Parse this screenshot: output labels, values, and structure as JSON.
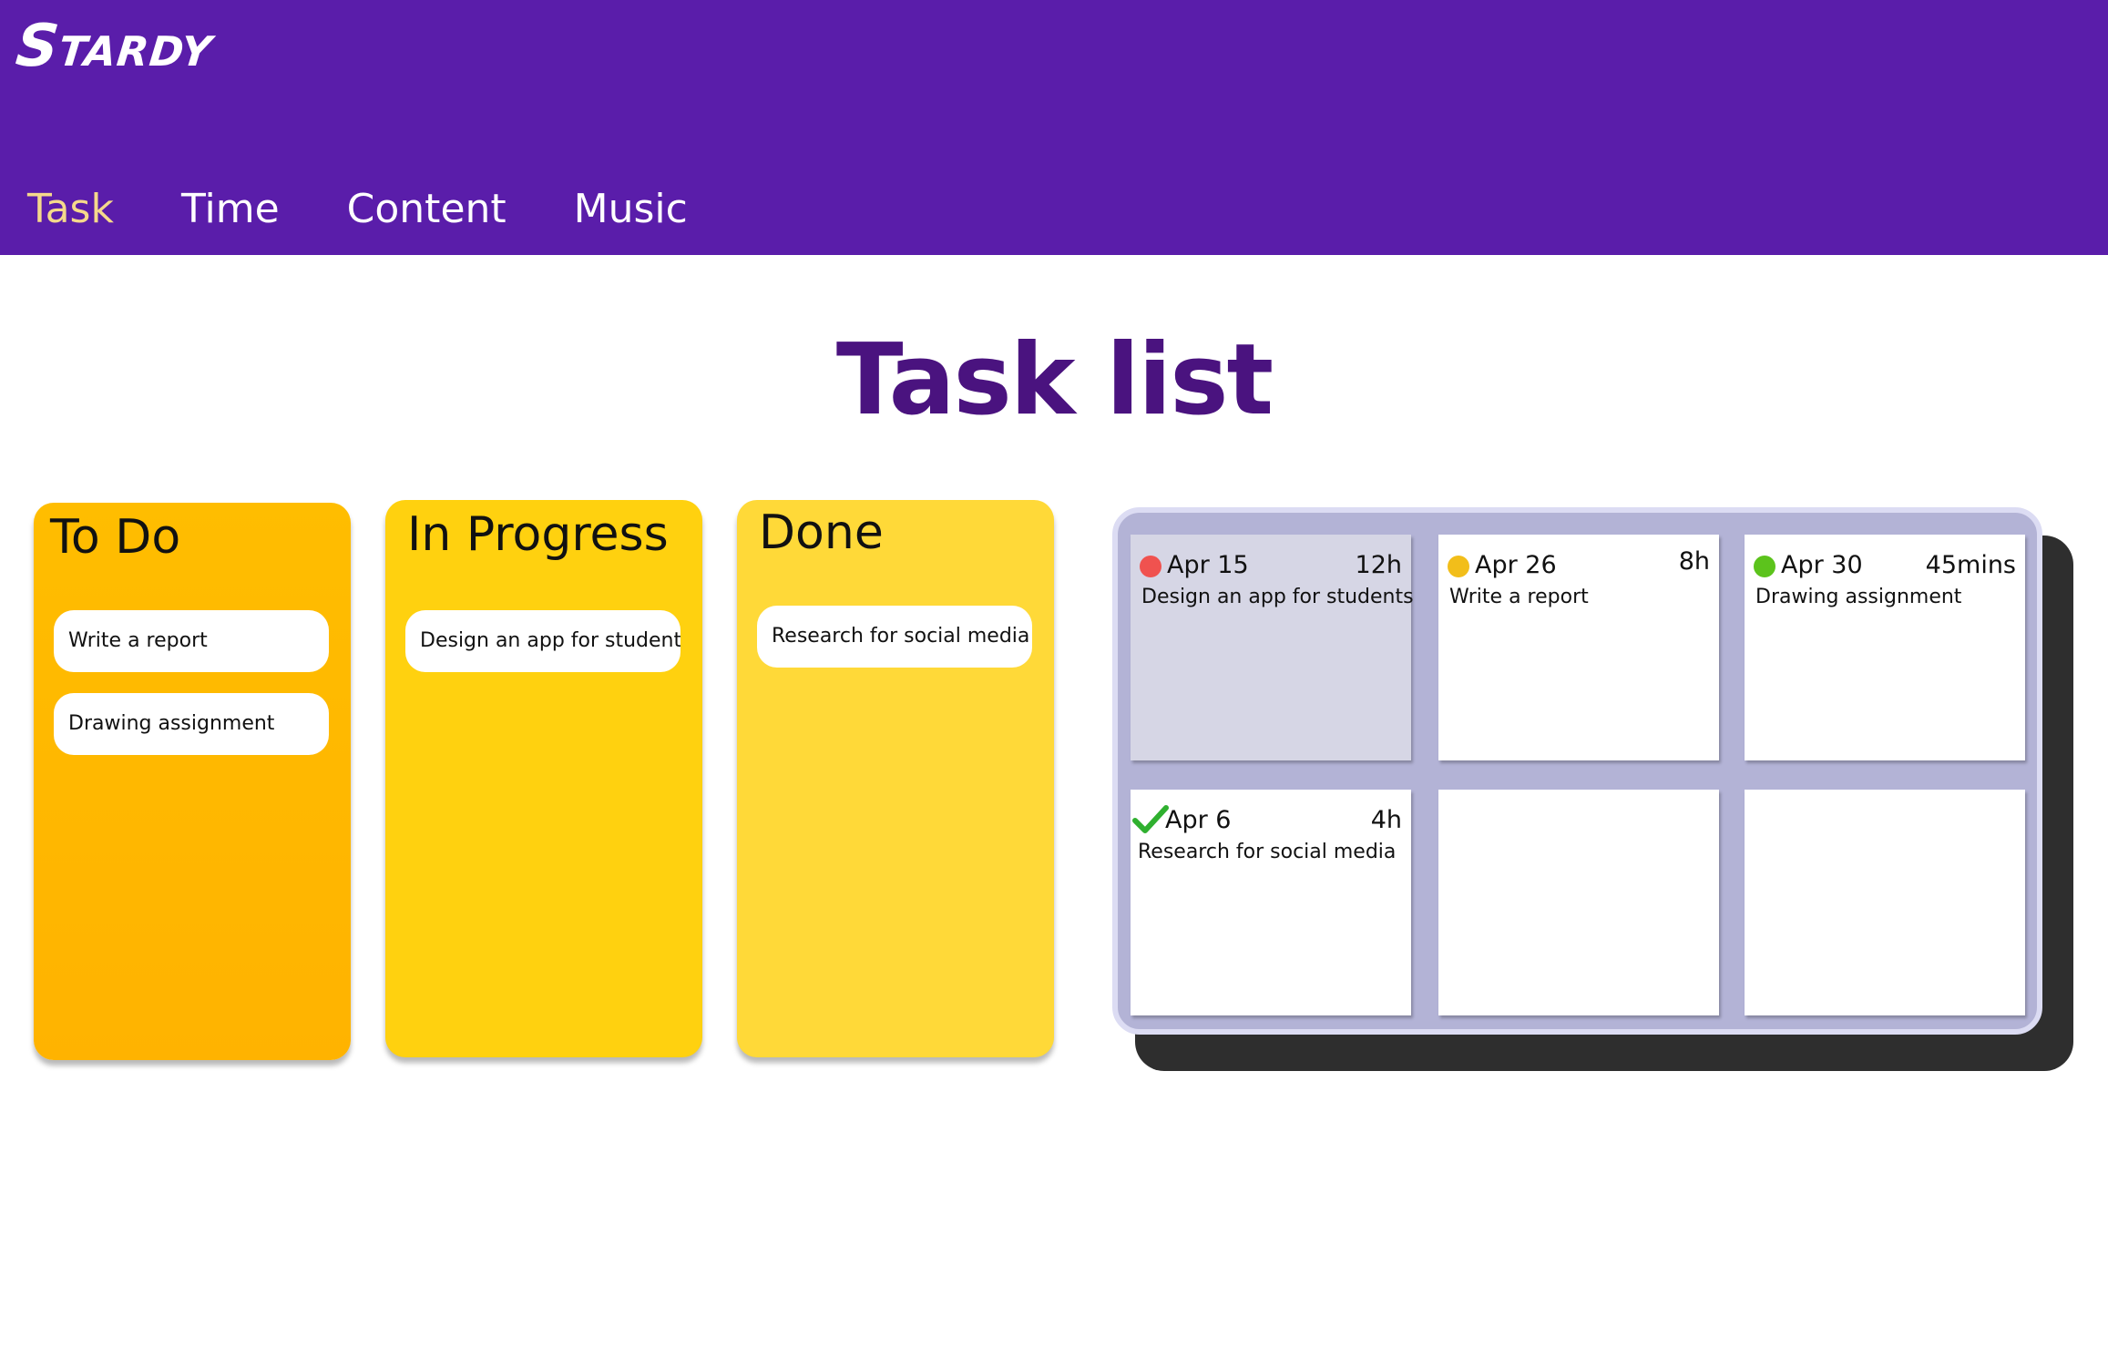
{
  "app": {
    "logo": "Stardy"
  },
  "nav": {
    "items": [
      {
        "label": "Task",
        "active": true
      },
      {
        "label": "Time",
        "active": false
      },
      {
        "label": "Content",
        "active": false
      },
      {
        "label": "Music",
        "active": false
      }
    ]
  },
  "page": {
    "title": "Task list"
  },
  "board": {
    "columns": [
      {
        "title": "To Do",
        "tasks": [
          "Write a report",
          "Drawing assignment"
        ]
      },
      {
        "title": "In Progress",
        "tasks": [
          "Design an app for students"
        ]
      },
      {
        "title": "Done",
        "tasks": [
          "Research for social media"
        ]
      }
    ]
  },
  "calendar": {
    "cards": [
      {
        "date": "Apr 15",
        "duration": "12h",
        "task": "Design an app for students",
        "status": "red-dot-icon",
        "color": "#f0524f"
      },
      {
        "date": "Apr 26",
        "duration": "8h",
        "task": "Write a report",
        "status": "yellow-dot-icon",
        "color": "#f2be1a"
      },
      {
        "date": "Apr 30",
        "duration": "45mins",
        "task": "Drawing assignment",
        "status": "green-dot-icon",
        "color": "#5cc31c"
      },
      {
        "date": "Apr 6",
        "duration": "4h",
        "task": "Research for social media",
        "status": "checkmark-icon",
        "color": "#2fb02f"
      }
    ]
  },
  "colors": {
    "header": "#5a1daa",
    "nav_active": "#f5d98b",
    "title": "#4a137f",
    "todo": "#ffbb00",
    "in_progress": "#ffd10f",
    "done": "#ffd938"
  }
}
